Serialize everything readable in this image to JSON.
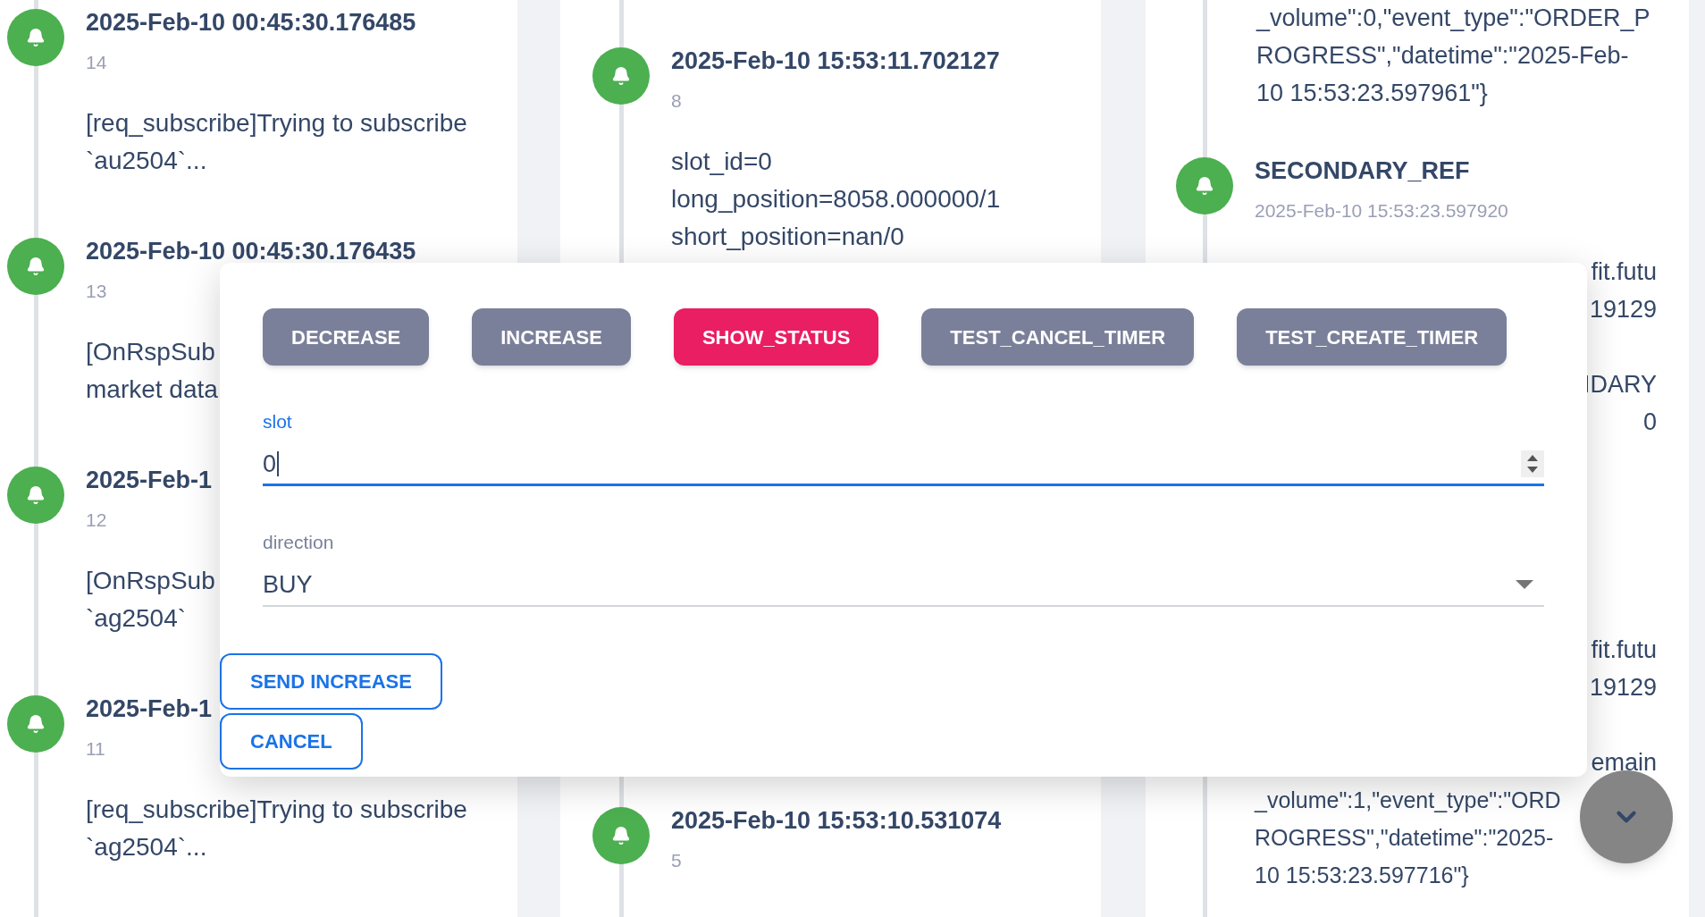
{
  "timeline": {
    "left": {
      "entries": [
        {
          "title": "2025-Feb-10 00:45:30.176485",
          "subtitle": "14",
          "body": [
            "[req_subscribe]Trying to subscribe",
            "`au2504`..."
          ]
        },
        {
          "title": "2025-Feb-10 00:45:30.176435",
          "subtitle": "13",
          "body": [
            "[OnRspSub",
            "market data"
          ]
        },
        {
          "title": "2025-Feb-1",
          "subtitle": "12",
          "body": [
            "[OnRspSub",
            "`ag2504`"
          ]
        },
        {
          "title": "2025-Feb-1",
          "subtitle": "11",
          "body": [
            "[req_subscribe]Trying to subscribe",
            "`ag2504`..."
          ]
        }
      ]
    },
    "middle": {
      "entries": [
        {
          "title": "2025-Feb-10 15:53:11.702127",
          "subtitle": "8",
          "body": [
            "slot_id=0",
            "long_position=8058.000000/1",
            "short_position=nan/0"
          ]
        },
        {
          "title": "2025-Feb-10 15:53:10.531074",
          "subtitle": "5"
        }
      ]
    },
    "right": {
      "top_lines": [
        "_volume\":0,\"event_type\":\"ORDER_P",
        "ROGRESS\",\"datetime\":\"2025-Feb-",
        "10 15:53:23.597961\"}"
      ],
      "entry": {
        "title": "SECONDARY_REF",
        "subtitle": "2025-Feb-10 15:53:23.597920",
        "fragments": [
          [
            "fit.futu",
            "19129"
          ],
          [
            "IDARY",
            "0"
          ],
          [
            "fit.futu",
            "19129"
          ],
          [
            "emain"
          ]
        ],
        "lines": [
          "_volume\":1,\"event_type\":\"ORD",
          "ROGRESS\",\"datetime\":\"2025-",
          "10 15:53:23.597716\"}"
        ]
      }
    }
  },
  "dialog": {
    "buttons": [
      {
        "label": "DECREASE",
        "kind": "default"
      },
      {
        "label": "INCREASE",
        "kind": "default"
      },
      {
        "label": "SHOW_STATUS",
        "kind": "accent"
      },
      {
        "label": "TEST_CANCEL_TIMER",
        "kind": "default"
      },
      {
        "label": "TEST_CREATE_TIMER",
        "kind": "default"
      }
    ],
    "fields": [
      {
        "label": "slot",
        "value": "0",
        "kind": "number",
        "focused": true
      },
      {
        "label": "direction",
        "value": "BUY",
        "kind": "select",
        "focused": false
      }
    ],
    "actions": [
      "SEND INCREASE",
      "CANCEL"
    ]
  }
}
